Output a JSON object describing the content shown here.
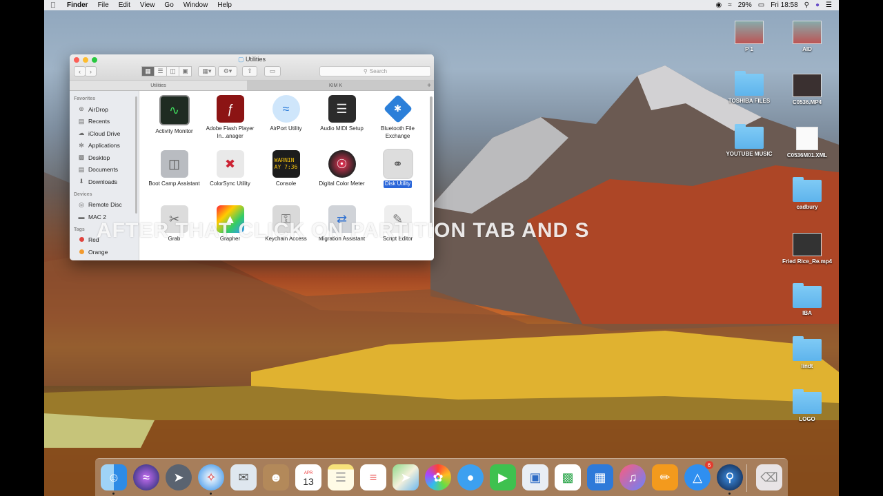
{
  "menubar": {
    "app_name": "Finder",
    "items": [
      "File",
      "Edit",
      "View",
      "Go",
      "Window",
      "Help"
    ],
    "battery": "29%",
    "clock": "Fri 18:58"
  },
  "window": {
    "title": "Utilities",
    "search_placeholder": "Search",
    "tabs": [
      "Utilities",
      "KIM K"
    ],
    "tab_plus": "+"
  },
  "sidebar": {
    "favorites_header": "Favorites",
    "favorites": [
      {
        "label": "AirDrop",
        "icon": "airdrop-icon"
      },
      {
        "label": "Recents",
        "icon": "recents-icon"
      },
      {
        "label": "iCloud Drive",
        "icon": "cloud-icon"
      },
      {
        "label": "Applications",
        "icon": "applications-icon"
      },
      {
        "label": "Desktop",
        "icon": "desktop-icon"
      },
      {
        "label": "Documents",
        "icon": "documents-icon"
      },
      {
        "label": "Downloads",
        "icon": "downloads-icon"
      }
    ],
    "devices_header": "Devices",
    "devices": [
      {
        "label": "Remote Disc",
        "icon": "disc-icon"
      },
      {
        "label": "MAC 2",
        "icon": "drive-icon"
      }
    ],
    "tags_header": "Tags",
    "tags": [
      {
        "label": "Red",
        "color": "#e0443e"
      },
      {
        "label": "Orange",
        "color": "#f29a2e"
      }
    ]
  },
  "apps": [
    {
      "label": "Activity Monitor",
      "icon": "activity-monitor-icon"
    },
    {
      "label": "Adobe Flash Player In...anager",
      "icon": "flash-icon"
    },
    {
      "label": "AirPort Utility",
      "icon": "airport-icon"
    },
    {
      "label": "Audio MIDI Setup",
      "icon": "midi-icon"
    },
    {
      "label": "Bluetooth File Exchange",
      "icon": "bluetooth-icon"
    },
    {
      "label": "Boot Camp Assistant",
      "icon": "bootcamp-icon"
    },
    {
      "label": "ColorSync Utility",
      "icon": "colorsync-icon"
    },
    {
      "label": "Console",
      "icon": "console-icon"
    },
    {
      "label": "Digital Color Meter",
      "icon": "color-meter-icon"
    },
    {
      "label": "Disk Utility",
      "icon": "disk-utility-icon",
      "selected": true
    },
    {
      "label": "Grab",
      "icon": "grab-icon"
    },
    {
      "label": "Grapher",
      "icon": "grapher-icon"
    },
    {
      "label": "Keychain Access",
      "icon": "keychain-icon"
    },
    {
      "label": "Migration Assistant",
      "icon": "migration-icon"
    },
    {
      "label": "Script Editor",
      "icon": "script-editor-icon"
    }
  ],
  "console_icon_text": "WARNIN\nAY 7:36",
  "caption": "AFTER THAT CLICK ON PARTITION TAB AND S",
  "desktop_icons": [
    {
      "label": "P 1",
      "kind": "thumb"
    },
    {
      "label": "AID",
      "kind": "thumb"
    },
    {
      "label": "TOSHIBA FILES",
      "kind": "folder"
    },
    {
      "label": "C0536.MP4",
      "kind": "thumb"
    },
    {
      "label": "YOUTUBE MUSIC",
      "kind": "folder"
    },
    {
      "label": "C0536M01.XML",
      "kind": "doc"
    },
    {
      "label": "cadbury",
      "kind": "folder"
    },
    {
      "label": "Fried Rice_Re.mp4",
      "kind": "thumb"
    },
    {
      "label": "IBA",
      "kind": "folder"
    },
    {
      "label": "lindt",
      "kind": "folder"
    },
    {
      "label": "LOGO",
      "kind": "folder"
    }
  ],
  "dock": {
    "items": [
      "finder-icon",
      "siri-icon",
      "launchpad-icon",
      "safari-icon",
      "mail-icon",
      "contacts-icon",
      "calendar-icon",
      "notes-icon",
      "reminders-icon",
      "maps-icon",
      "photos-icon",
      "messages-icon",
      "facetime-icon",
      "preview-icon",
      "numbers-icon",
      "keynote-icon",
      "itunes-icon",
      "ibooks-icon",
      "app-store-icon",
      "quicktime-icon",
      "trash-icon"
    ],
    "calendar_month": "APR",
    "calendar_day": "13",
    "app_store_badge": "6"
  }
}
